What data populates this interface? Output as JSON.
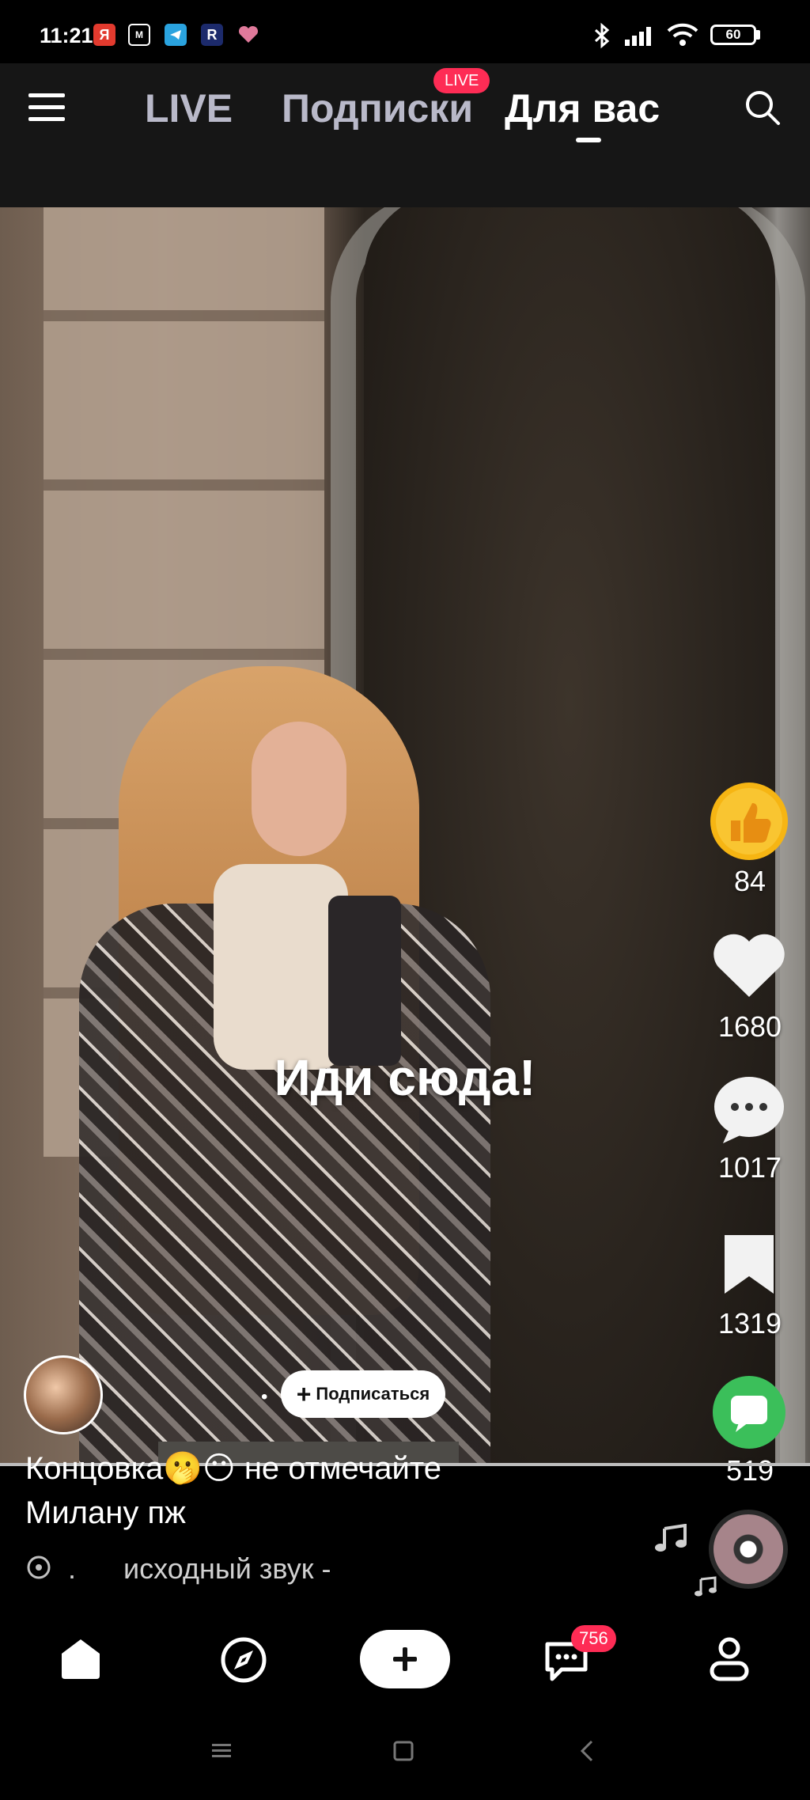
{
  "status_bar": {
    "time": "11:21",
    "app_icons": [
      "yandex-icon",
      "mail-icon",
      "telegram-icon",
      "r-app-icon",
      "heart-app-icon"
    ],
    "system_icons": [
      "bluetooth-icon",
      "signal-icon",
      "wifi-icon"
    ],
    "battery": "60"
  },
  "top_nav": {
    "menu_icon": "hamburger-menu-icon",
    "tabs": [
      {
        "label": "LIVE",
        "active": false
      },
      {
        "label": "Подписки",
        "active": false,
        "badge": "LIVE"
      },
      {
        "label": "Для вас",
        "active": true
      }
    ],
    "search_icon": "search-icon"
  },
  "video": {
    "caption": "Иди сюда!",
    "author_follow_label": "Подписаться",
    "description_line1": "Концовка🫢😶 не отмечайте",
    "description_line2": "Милану пж",
    "sound_prefix": ".",
    "sound": "исходный звук -"
  },
  "actions": {
    "boost_count": "84",
    "likes": "1680",
    "comments": "1017",
    "saves": "1319",
    "shares": "519"
  },
  "colors": {
    "accent": "#fe2c55",
    "share_green": "#3bbf5a",
    "boost_yellow": "#f6b513"
  },
  "bottom_nav": {
    "items": [
      "home-icon",
      "discover-icon",
      "create-icon",
      "inbox-icon",
      "profile-icon"
    ],
    "inbox_badge": "756"
  },
  "system_nav": [
    "recents-icon",
    "home-square-icon",
    "back-icon"
  ]
}
